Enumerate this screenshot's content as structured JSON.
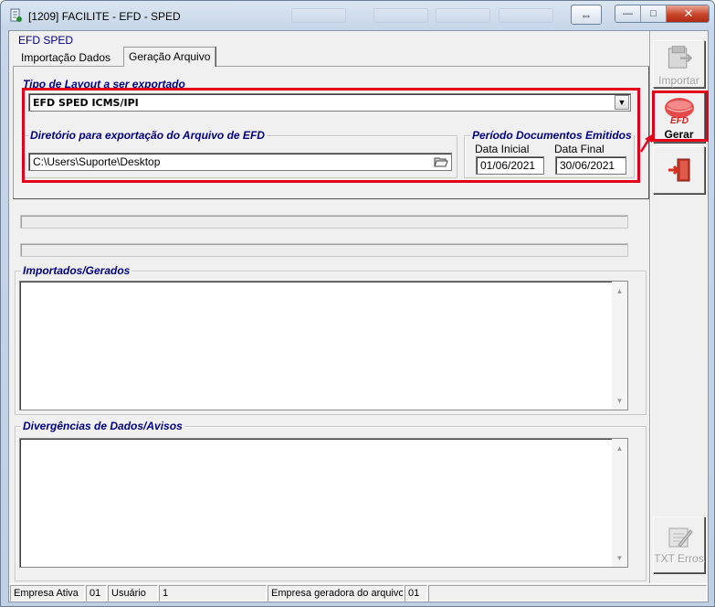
{
  "window": {
    "title": "[1209] FACILITE - EFD - SPED",
    "restore_glyph": "⇔",
    "minimize_glyph": "—",
    "maximize_glyph": "□",
    "close_glyph": "✕"
  },
  "form": {
    "group_label": "EFD SPED",
    "tabs": [
      {
        "label": "Importação Dados"
      },
      {
        "label": "Geração Arquivo"
      }
    ],
    "layout_group": {
      "label": "Tipo de Layout a ser exportado",
      "selected": "EFD SPED ICMS/IPI"
    },
    "directory_group": {
      "label": "Diretório para exportação do Arquivo de EFD",
      "path": "C:\\Users\\Suporte\\Desktop"
    },
    "period_group": {
      "label": "Período Documentos Emitidos",
      "start_label": "Data Inicial",
      "start_value": "01/06/2021",
      "end_label": "Data Final",
      "end_value": "30/06/2021"
    },
    "progress": [
      0,
      0
    ],
    "imported_label": "Importados/Gerados",
    "divergences_label": "Divergências de Dados/Avisos"
  },
  "toolbar": {
    "importar": "Importar",
    "gerar": "Gerar",
    "gerar_icon_text": "EFD",
    "txt_erros": "TXT Erros"
  },
  "status": {
    "empresa_ativa_label": "Empresa Ativa",
    "empresa_ativa_value": "01",
    "usuario_label": "Usuário",
    "usuario_value": "1",
    "empresa_geradora_label": "Empresa geradora do arquivo",
    "empresa_geradora_value": "01"
  },
  "colors": {
    "annotation_red": "#e2001a",
    "group_label_blue": "#00007f"
  }
}
